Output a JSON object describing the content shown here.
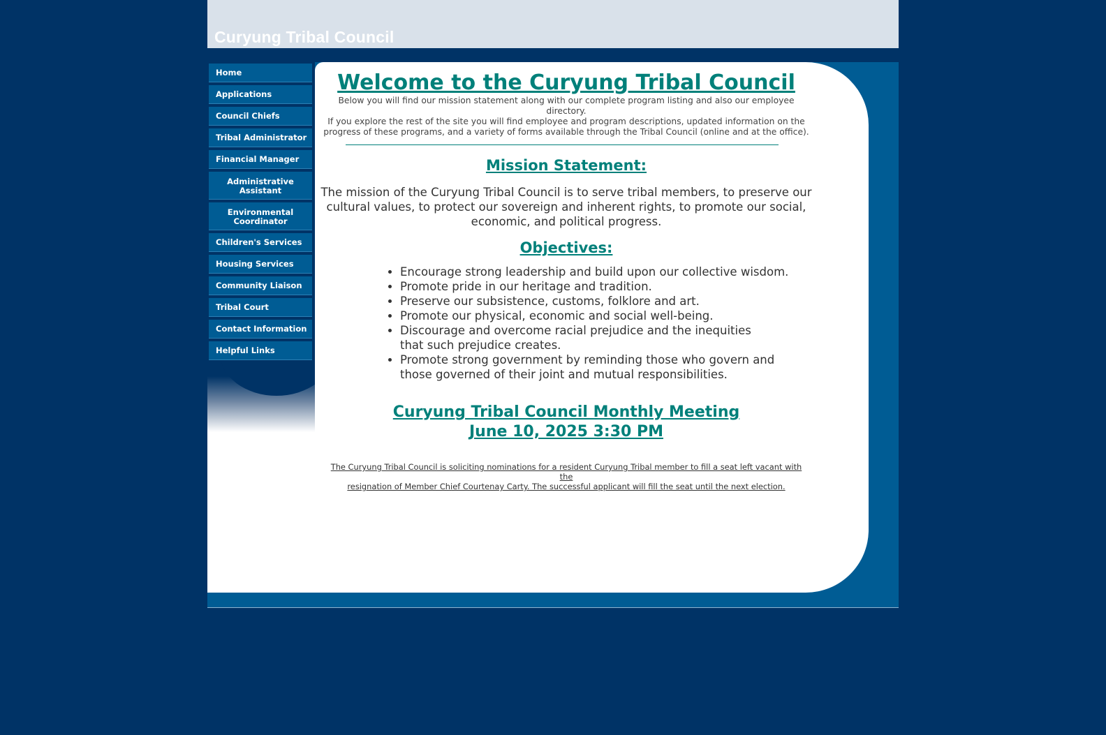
{
  "site": {
    "title": "Curyung Tribal Council"
  },
  "nav": {
    "items": [
      {
        "label": "Home"
      },
      {
        "label": "Applications"
      },
      {
        "label": "Council Chiefs"
      },
      {
        "label": "Tribal Administrator"
      },
      {
        "label": "Financial Manager"
      },
      {
        "label": "Administrative Assistant"
      },
      {
        "label": "Environmental Coordinator"
      },
      {
        "label": "Children's Services"
      },
      {
        "label": "Housing Services"
      },
      {
        "label": "Community Liaison"
      },
      {
        "label": "Tribal Court"
      },
      {
        "label": "Contact Information"
      },
      {
        "label": "Helpful Links"
      }
    ]
  },
  "main": {
    "heading": "Welcome to the Curyung Tribal Council",
    "intro_lines": [
      "Below you will find our mission statement along with our complete program listing and also our employee directory.",
      "If you explore the rest of the site you will find employee and program descriptions, updated information on the",
      "progress of these programs, and a variety of forms available through the Tribal Council (online and at the office)."
    ],
    "mission_heading": "Mission Statement:",
    "mission_lines": [
      "The mission of the Curyung Tribal Council is to serve tribal members, to preserve our",
      "cultural values, to protect our sovereign and inherent rights, to promote our social,",
      "economic, and political progress."
    ],
    "objectives_heading": "Objectives:",
    "objectives": [
      "Encourage strong leadership and build upon our collective wisdom.",
      "Promote pride in our heritage and tradition.",
      "Preserve our subsistence, customs, folklore and art.",
      "Promote our physical, economic and social well-being.",
      "Discourage and overcome racial prejudice and the inequities that such prejudice creates.",
      "Promote strong government by reminding those who govern and those governed of their joint and mutual responsibilities."
    ],
    "meeting_title": "Curyung Tribal Council Monthly Meeting",
    "meeting_date": "June 10, 2025 3:30 PM",
    "notice_lines": [
      "The Curyung Tribal Council is soliciting nominations for a resident Curyung Tribal member to fill a seat left vacant with the",
      "resignation of Member Chief Courtenay Carty.  The successful applicant will fill the seat until the next election."
    ]
  },
  "colors": {
    "page_bg": "#003366",
    "header_bg": "#d9e1ea",
    "nav_bg": "#005c94",
    "heading_teal": "#00807a"
  }
}
